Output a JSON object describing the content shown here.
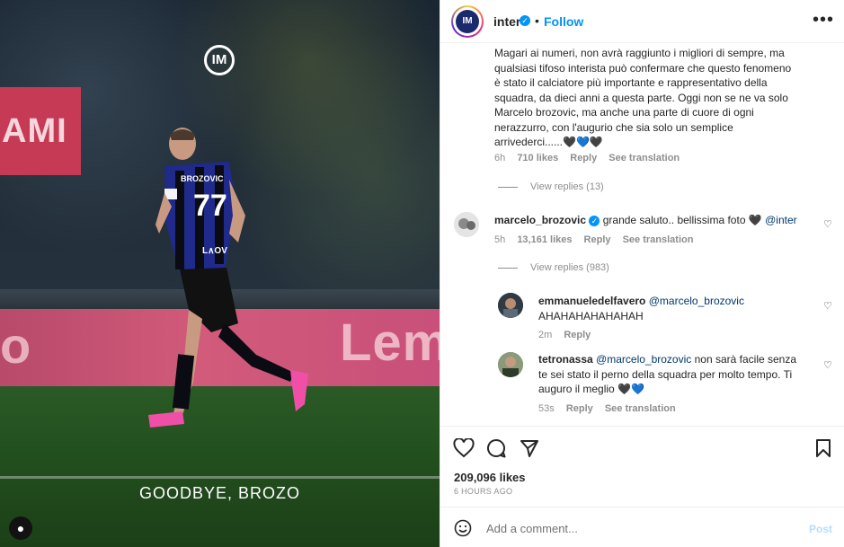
{
  "media": {
    "caption": "GOODBYE, BROZO",
    "ad_left_text": "AMI",
    "ad_board_text": "Lem",
    "ad_board_left_text": "o",
    "jersey_name": "BROZOVIC",
    "jersey_number": "77",
    "jersey_sponsor": "L∧OV"
  },
  "header": {
    "username": "inter",
    "dot": "•",
    "follow_label": "Follow",
    "more_label": "•••"
  },
  "comments": [
    {
      "text_lines": [
        "Magari ai numeri, non avrà raggiunto i migliori di sempre, ma",
        "qualsiasi tifoso interista può confermare che questo fenomeno",
        "è stato il calciatore più importante e rappresentativo della",
        "squadra, da dieci anni a questa parte. Oggi non se ne va solo",
        "Marcelo brozovic, ma anche una parte di cuore di ogni",
        "nerazzurro, con l'augurio che sia solo un semplice",
        "arrivederci......🖤💙🖤"
      ],
      "time": "6h",
      "likes": "710 likes",
      "reply": "Reply",
      "translation": "See translation",
      "view_replies": "View replies (13)"
    },
    {
      "username": "marcelo_brozovic",
      "text": "grande saluto.. bellissima foto 🖤",
      "mention": "@inter",
      "time": "5h",
      "likes": "13,161 likes",
      "reply": "Reply",
      "translation": "See translation",
      "view_replies": "View replies (983)"
    },
    {
      "username": "emmanueledelfavero",
      "mention": "@marcelo_brozovic",
      "text": "AHAHAHAHAHAHAH",
      "time": "2m",
      "reply": "Reply"
    },
    {
      "username": "tetronassa",
      "mention": "@marcelo_brozovic",
      "text_first": "non sarà facile senza",
      "text_lines": [
        "te sei stato il perno della squadra per molto tempo. Ti",
        "auguro il meglio 🖤💙"
      ],
      "time": "53s",
      "reply": "Reply",
      "translation": "See translation"
    }
  ],
  "stats": {
    "likes": "209,096 likes",
    "time": "6 HOURS AGO"
  },
  "add_comment": {
    "placeholder": "Add a comment...",
    "post_label": "Post"
  },
  "colors": {
    "follow": "#0095f6",
    "verified": "#0095f6",
    "post_disabled": "#b2dffc",
    "mention": "#00376b"
  }
}
